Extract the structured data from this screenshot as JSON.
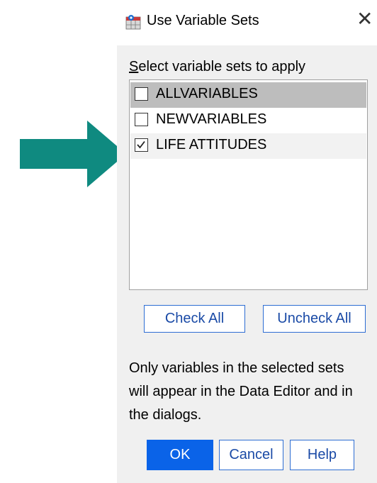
{
  "annotation": {
    "arrow_color": "#0f8a80"
  },
  "dialog": {
    "title": "Use Variable Sets",
    "close_glyph": "✕",
    "prompt": "Select variable sets to apply",
    "sets": [
      {
        "label": "ALLVARIABLES",
        "checked": false
      },
      {
        "label": "NEWVARIABLES",
        "checked": false
      },
      {
        "label": "LIFE ATTITUDES",
        "checked": true
      }
    ],
    "check_all_label": "Check All",
    "uncheck_all_label": "Uncheck All",
    "note": "Only variables in the selected sets will appear in the Data Editor and in the dialogs.",
    "ok_label": "OK",
    "cancel_label": "Cancel",
    "help_label": "Help",
    "accent_color": "#0a63e8"
  }
}
